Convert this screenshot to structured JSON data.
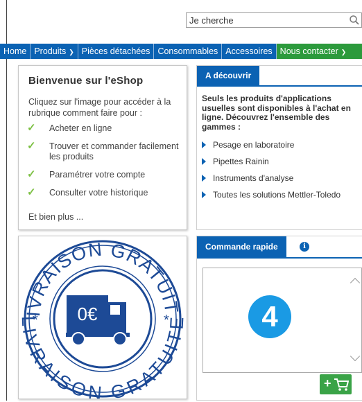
{
  "search": {
    "placeholder": "Je cherche"
  },
  "nav": {
    "items": [
      {
        "label": "Home"
      },
      {
        "label": "Produits"
      },
      {
        "label": "Pièces détachées"
      },
      {
        "label": "Consommables"
      },
      {
        "label": "Accessoires"
      },
      {
        "label": "Nous contacter"
      }
    ]
  },
  "welcome": {
    "title": "Bienvenue sur l'eShop",
    "intro": "Cliquez sur l'image pour accéder à la rubrique comment faire pour :",
    "items": [
      "Acheter en ligne",
      "Trouver et commander facilement les produits",
      "Paramétrer votre compte",
      "Consulter votre historique"
    ],
    "more": "Et bien plus ..."
  },
  "discover": {
    "tab": "A découvrir",
    "description": "Seuls les produits d'applications usuelles sont disponibles à l'achat en ligne. Découvrez l'ensemble des gammes :",
    "links": [
      "Pesage en laboratoire",
      "Pipettes Rainin",
      "Instruments d'analyse",
      "Toutes les solutions Mettler-Toledo"
    ]
  },
  "shipping": {
    "ring_top": "LIVRAISON GRATUITE",
    "ring_bottom": "LIVRAISON GRATUITE",
    "price": "0€"
  },
  "quick_order": {
    "tab": "Commande rapide",
    "info_icon": "i",
    "step_badge": "4"
  },
  "colors": {
    "nav_blue": "#0b62b3",
    "contact_green": "#2c9a3c",
    "stamp_blue": "#1d4a96",
    "badge_blue": "#1a9ae4",
    "check_green": "#7cc043"
  }
}
